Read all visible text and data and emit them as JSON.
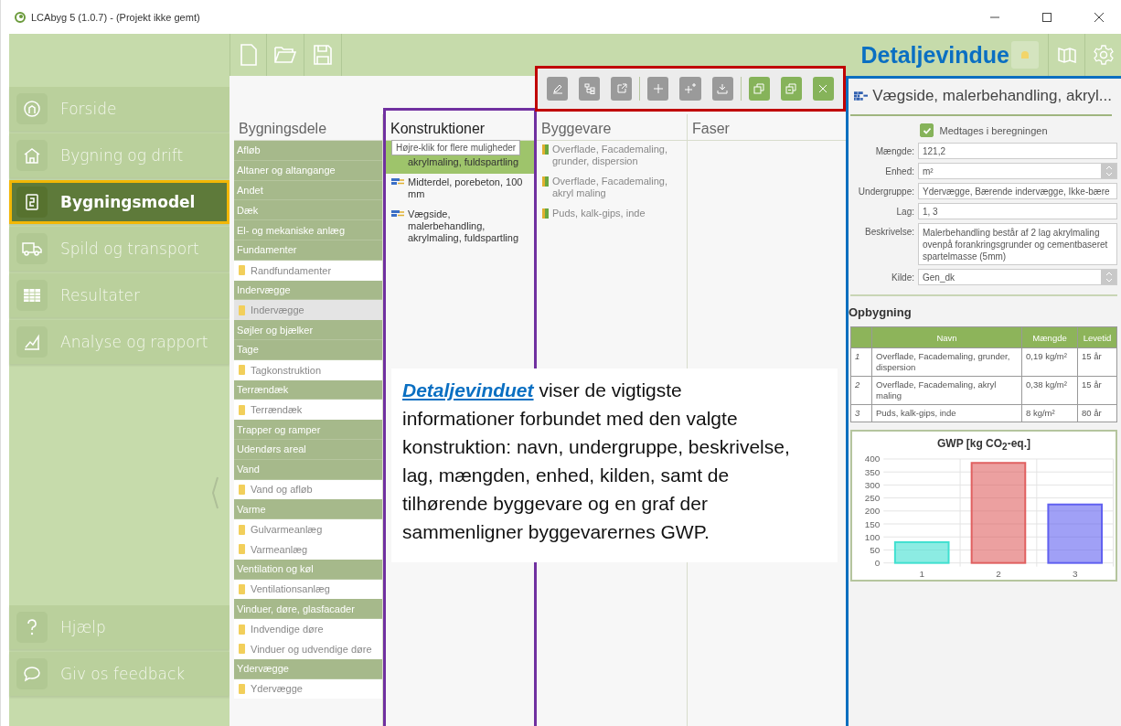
{
  "window": {
    "title": "LCAbyg 5 (1.0.7) - (Projekt ikke gemt)"
  },
  "sidebar": {
    "items": [
      {
        "label": "Forside",
        "selected": false
      },
      {
        "label": "Bygning og drift",
        "selected": false
      },
      {
        "label": "Bygningsmodel",
        "selected": true
      },
      {
        "label": "Spild og transport",
        "selected": false
      },
      {
        "label": "Resultater",
        "selected": false
      },
      {
        "label": "Analyse og rapport",
        "selected": false
      }
    ],
    "bottom_items": [
      {
        "label": "Hjælp",
        "selected": false
      },
      {
        "label": "Giv os feedback",
        "selected": false
      }
    ]
  },
  "detail_caption": "Detaljevindue",
  "columns": {
    "headers": [
      "Bygningsdele",
      "Konstruktioner",
      "Byggevare",
      "Faser"
    ]
  },
  "bygningsdele": [
    {
      "label": "Afløb"
    },
    {
      "label": "Altaner og altangange"
    },
    {
      "label": "Andet"
    },
    {
      "label": "Dæk"
    },
    {
      "label": "El- og mekaniske anlæg"
    },
    {
      "label": "Fundamenter",
      "children": [
        {
          "label": "Randfundamenter",
          "selected": false
        }
      ]
    },
    {
      "label": "Indervægge",
      "children": [
        {
          "label": "Indervægge",
          "selected": true
        }
      ]
    },
    {
      "label": "Søjler og bjælker"
    },
    {
      "label": "Tage",
      "children": [
        {
          "label": "Tagkonstruktion",
          "selected": false
        }
      ]
    },
    {
      "label": "Terrændæk",
      "children": [
        {
          "label": "Terrændæk",
          "selected": false
        }
      ]
    },
    {
      "label": "Trapper og ramper"
    },
    {
      "label": "Udendørs areal"
    },
    {
      "label": "Vand",
      "children": [
        {
          "label": "Vand og afløb",
          "selected": false
        }
      ]
    },
    {
      "label": "Varme",
      "children": [
        {
          "label": "Gulvarmeanlæg",
          "selected": false
        },
        {
          "label": "Varmeanlæg",
          "selected": false
        }
      ]
    },
    {
      "label": "Ventilation og køl",
      "children": [
        {
          "label": "Ventilationsanlæg",
          "selected": false
        }
      ]
    },
    {
      "label": "Vinduer, døre, glasfacader",
      "children": [
        {
          "label": "Indvendige døre",
          "selected": false
        },
        {
          "label": "Vinduer og udvendige døre",
          "selected": false
        }
      ]
    },
    {
      "label": "Ydervægge",
      "children": [
        {
          "label": "Ydervægge",
          "selected": false
        }
      ]
    }
  ],
  "konstruktioner": [
    {
      "label": "akrylmaling, fuldspartling",
      "selected": true,
      "under_tooltip": true
    },
    {
      "label": "Midterdel, porebeton, 100 mm",
      "selected": false,
      "under_tooltip": false
    },
    {
      "label": "Vægside, malerbehandling, akrylmaling, fuldspartling",
      "selected": false,
      "under_tooltip": false
    }
  ],
  "tooltip": "Højre-klik for flere muligheder",
  "byggevare": [
    {
      "label": "Overflade, Facademaling, grunder, dispersion"
    },
    {
      "label": "Overflade, Facademaling, akryl maling"
    },
    {
      "label": "Puds, kalk-gips, inde"
    }
  ],
  "annotation": {
    "link": "Detaljevinduet",
    "text": " viser de vigtigste informationer forbundet med den valgte konstruktion: navn, undergruppe, beskrivelse, lag, mængden, enhed, kilden, samt de tilhørende byggevare og en graf der sammenligner byggevarernes GWP."
  },
  "detail": {
    "title": "Vægside, malerbehandling, akryl...",
    "include": {
      "label": "Medtages i beregningen",
      "checked": true
    },
    "fields": [
      {
        "label": "Mængde:",
        "kind": "input",
        "value": "121,2"
      },
      {
        "label": "Enhed:",
        "kind": "select",
        "value": "m²"
      },
      {
        "label": "Undergruppe:",
        "kind": "input",
        "value": "Ydervægge, Bærende indervægge, Ikke-bære"
      },
      {
        "label": "Lag:",
        "kind": "input",
        "value": "1, 3"
      },
      {
        "label": "Beskrivelse:",
        "kind": "textarea",
        "value": "Malerbehandling består af 2 lag akrylmaling ovenpå forankringsgrunder og cementbaseret spartelmasse (5mm)"
      },
      {
        "label": "Kilde:",
        "kind": "select",
        "value": "Gen_dk"
      }
    ],
    "section": "Opbygning",
    "table": {
      "columns": [
        "",
        "Navn",
        "Mængde",
        "Levetid"
      ],
      "rows": [
        [
          "1",
          "Overflade, Facademaling, grunder, dispersion",
          "0,19 kg/m²",
          "15 år"
        ],
        [
          "2",
          "Overflade, Facademaling, akryl maling",
          "0,38 kg/m²",
          "15 år"
        ],
        [
          "3",
          "Puds, kalk-gips, inde",
          "8 kg/m²",
          "80 år"
        ]
      ]
    },
    "chart_data": {
      "type": "bar",
      "title": "GWP [kg CO$_{2}$-eq.]",
      "categories": [
        "1",
        "2",
        "3"
      ],
      "stacked": true,
      "grid": true,
      "ylim": [
        0,
        400
      ],
      "yticks": [
        0,
        50,
        100,
        150,
        200,
        250,
        300,
        350,
        400
      ],
      "series": [
        {
          "color": "#40e0d0",
          "values": [
            80,
            null,
            null
          ]
        },
        {
          "color": "#e06060",
          "values": [
            null,
            385,
            null
          ]
        },
        {
          "color": "#6060f0",
          "values": [
            null,
            null,
            225
          ]
        }
      ]
    }
  }
}
